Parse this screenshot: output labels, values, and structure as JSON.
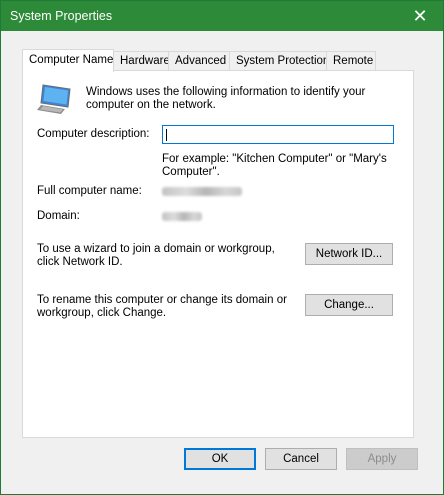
{
  "window": {
    "title": "System Properties",
    "close_glyph": "✕"
  },
  "tabs": [
    {
      "label": "Computer Name",
      "active": true
    },
    {
      "label": "Hardware"
    },
    {
      "label": "Advanced"
    },
    {
      "label": "System Protection"
    },
    {
      "label": "Remote"
    }
  ],
  "computer_name_tab": {
    "intro_text": "Windows uses the following information to identify your computer on the network.",
    "description_label": "Computer description:",
    "description_value": "",
    "example_text": "For example: \"Kitchen Computer\" or \"Mary's Computer\".",
    "full_name_label": "Full computer name:",
    "domain_label": "Domain:",
    "network_id_text": "To use a wizard to join a domain or workgroup, click Network ID.",
    "network_id_button": "Network ID...",
    "rename_text": "To rename this computer or change its domain or workgroup, click Change.",
    "change_button": "Change..."
  },
  "dialog_buttons": {
    "ok": "OK",
    "cancel": "Cancel",
    "apply": "Apply"
  },
  "icons": {
    "computer": "computer-monitor-icon",
    "close": "close-icon"
  },
  "colors": {
    "titlebar": "#2c8a38",
    "focus_border": "#0078d7"
  }
}
